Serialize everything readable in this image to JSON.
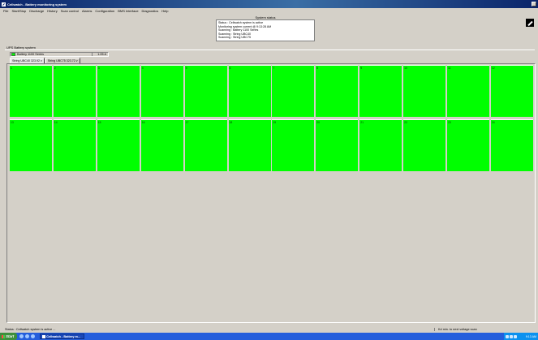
{
  "window": {
    "title": "Cellwatch - Battery monitoring system"
  },
  "menu": [
    "File",
    "Start/Stop",
    "Discharge",
    "History",
    "Scan control",
    "Alarms",
    "Configuration",
    "BMS Interface",
    "Diagnostics",
    "Help"
  ],
  "system_status": {
    "caption": "System status",
    "lines": [
      "Status : Cellwatch system is active",
      "Monitoring system current @ 9:13:28 AM",
      "Scanning : Battery 1100 Series",
      "Scanning : String UBC40",
      "Scanning : String UBC75"
    ]
  },
  "section": {
    "label": "UPS Battery system"
  },
  "battery": {
    "name": "Battery 1100 Series",
    "voltage": "1.05 A",
    "status_color": "#00ff00"
  },
  "tabs": [
    {
      "label": "String UBC40 323.92 v",
      "active": true
    },
    {
      "label": "String UBC75 323.72 v",
      "active": false
    }
  ],
  "cells": {
    "color": "#00ff00",
    "row1": [
      "1",
      "2",
      "3",
      "4",
      "5",
      "6",
      "7",
      "8",
      "9",
      "10",
      "11",
      "12"
    ],
    "row2": [
      "13",
      "14",
      "15",
      "16",
      "17",
      "18",
      "19",
      "20",
      "21",
      "22",
      "23",
      "24"
    ]
  },
  "statusbar": {
    "left": "Status : Cellwatch system is active ...",
    "right": "Kd min. to next voltage scan"
  },
  "taskbar": {
    "start_label": "Start",
    "task_label": "Cellwatch - Battery m...",
    "clock": "9:13 AM"
  }
}
